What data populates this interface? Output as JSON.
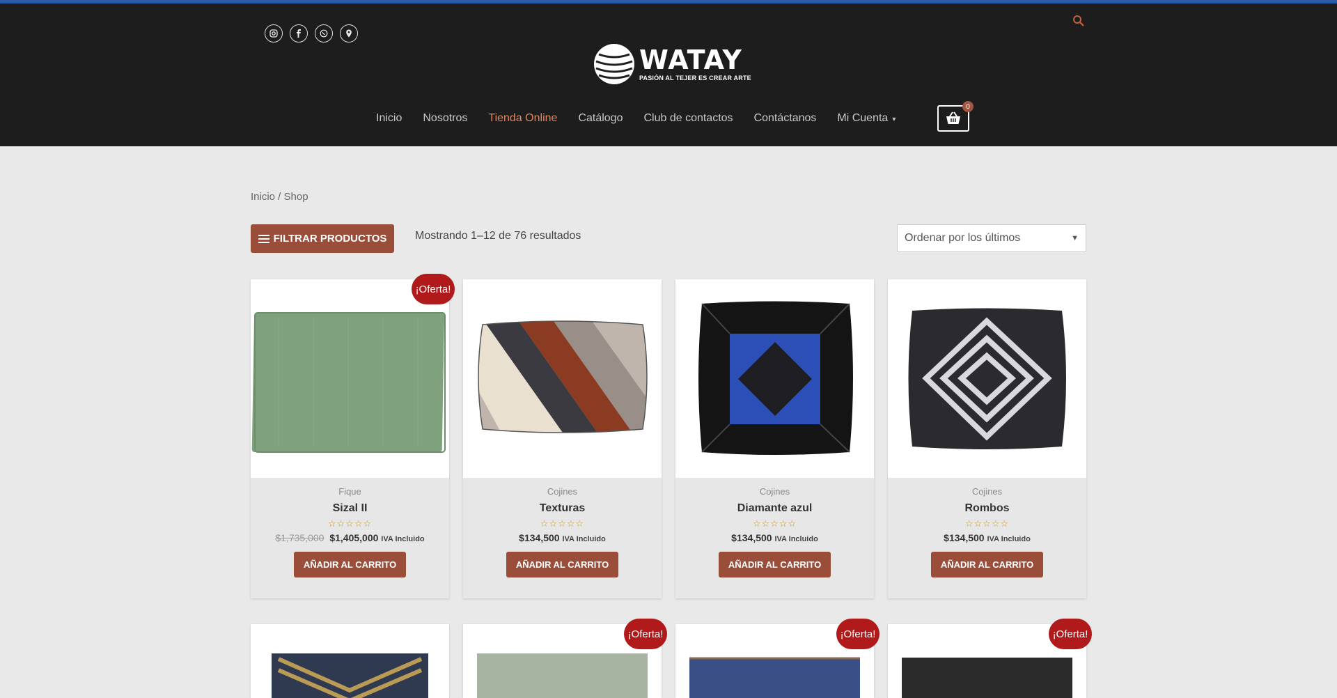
{
  "header": {
    "social_icons": [
      "instagram-icon",
      "facebook-icon",
      "whatsapp-icon",
      "location-pin-icon"
    ],
    "logo_name": "WATAY",
    "logo_tagline": "PASIÓN AL TEJER ES CREAR ARTE",
    "nav": [
      {
        "label": "Inicio",
        "active": false
      },
      {
        "label": "Nosotros",
        "active": false
      },
      {
        "label": "Tienda Online",
        "active": true
      },
      {
        "label": "Catálogo",
        "active": false
      },
      {
        "label": "Club de contactos",
        "active": false
      },
      {
        "label": "Contáctanos",
        "active": false
      },
      {
        "label": "Mi Cuenta",
        "active": false
      }
    ],
    "cart_count": "0"
  },
  "shop": {
    "breadcrumb": "Inicio / Shop",
    "filter_label": "FILTRAR PRODUCTOS",
    "results_text": "Mostrando 1–12 de 76 resultados",
    "sort_value": "Ordenar por los últimos"
  },
  "products": [
    {
      "category": "Fique",
      "title": "Sizal II",
      "old_price": "$1,735,000",
      "price": "$1,405,000",
      "iva": "IVA Incluido",
      "button": "AÑADIR AL CARRITO",
      "badge": "¡Oferta!"
    },
    {
      "category": "Cojines",
      "title": "Texturas",
      "old_price": "",
      "price": "$134,500",
      "iva": "IVA Incluido",
      "button": "AÑADIR AL CARRITO",
      "badge": ""
    },
    {
      "category": "Cojines",
      "title": "Diamante azul",
      "old_price": "",
      "price": "$134,500",
      "iva": "IVA Incluido",
      "button": "AÑADIR AL CARRITO",
      "badge": ""
    },
    {
      "category": "Cojines",
      "title": "Rombos",
      "old_price": "",
      "price": "$134,500",
      "iva": "IVA Incluido",
      "button": "AÑADIR AL CARRITO",
      "badge": ""
    }
  ],
  "row2_badges": [
    "",
    "¡Oferta!",
    "¡Oferta!",
    "¡Oferta!"
  ],
  "rating_stars": "☆☆☆☆☆",
  "colors": {
    "header_bg": "#1d1d1d",
    "accent": "#9a4d38",
    "nav_active": "#e0875d",
    "sale_badge": "#b01a1a"
  }
}
